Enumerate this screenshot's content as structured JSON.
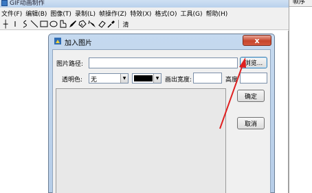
{
  "app": {
    "title": "GIF动画制作",
    "menu": [
      "文件(F)",
      "编辑(B)",
      "图像(T)",
      "录制(L)",
      "帧操作(Z)",
      "特效(X)",
      "格式(O)",
      "工具(G)",
      "帮助(H)"
    ],
    "toolbar": {
      "tools": [
        "line-tool",
        "text-cursor-tool",
        "curve-tool",
        "diagonal-line-tool",
        "rectangle-tool",
        "ellipse-tool",
        "rounded-rect-tool",
        "pencil-tool",
        "fill-tool",
        "brush-tool",
        "eraser-tool",
        "color-picker-tool"
      ],
      "extra_label": "清"
    }
  },
  "right_panel": {
    "header": "帧序"
  },
  "dialog": {
    "title": "加入图片",
    "close_label": "x",
    "path_label": "图片路径:",
    "path_value": "",
    "browse_label": "浏览...",
    "transparent_label": "透明色:",
    "transparent_value": "无",
    "color_value": "#000000",
    "width_label": "画出宽度:",
    "width_value": "",
    "height_label": "高度",
    "height_value": "",
    "ok_label": "确定",
    "cancel_label": "取消"
  },
  "annotation": {
    "arrow_color": "#e02020"
  }
}
